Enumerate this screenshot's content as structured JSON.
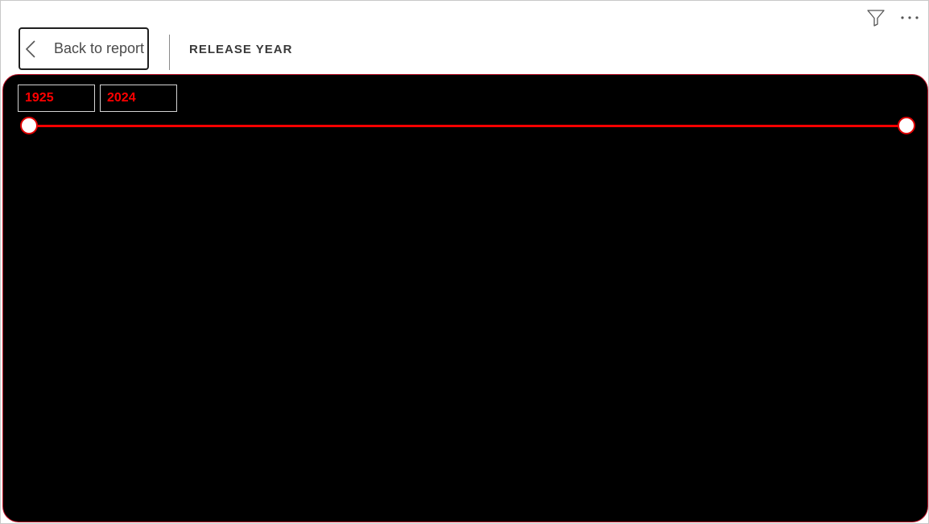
{
  "header": {
    "back_label": "Back to report",
    "title": "RELEASE YEAR"
  },
  "top_icons": [
    "filter-icon",
    "more-options-icon"
  ],
  "slicer": {
    "start_value": "1925",
    "end_value": "2024",
    "range_min": 1925,
    "range_max": 2024,
    "selected_start": 1925,
    "selected_end": 2024
  },
  "colors": {
    "panel_background": "#000000",
    "accent": "#ff0000",
    "panel_border": "#c0142a",
    "title_text": "#3a3a3a"
  }
}
